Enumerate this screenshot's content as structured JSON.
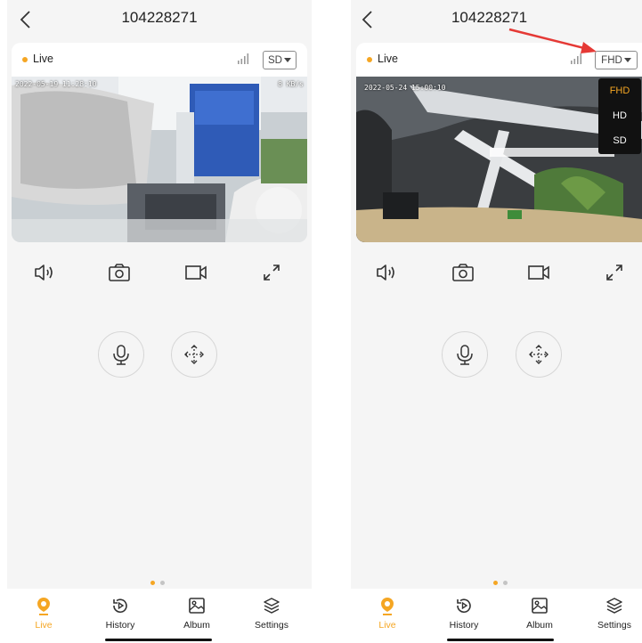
{
  "device_title": "104228271",
  "live_label": "Live",
  "left_screen": {
    "quality_label": "SD",
    "osd_timestamp": "2022-05-19 11:28:10",
    "osd_bitrate": "8 KB/s"
  },
  "right_screen": {
    "quality_label": "FHD",
    "osd_timestamp": "2022-05-24 15:00:10",
    "quality_menu": [
      "FHD",
      "HD",
      "SD"
    ],
    "quality_selected": "FHD"
  },
  "controls": [
    "speaker-icon",
    "snapshot-icon",
    "record-icon",
    "fullscreen-icon"
  ],
  "actions": [
    "microphone-icon",
    "ptz-icon"
  ],
  "tabs": [
    {
      "label": "Live",
      "icon": "live-pin-icon",
      "active": true
    },
    {
      "label": "History",
      "icon": "history-icon",
      "active": false
    },
    {
      "label": "Album",
      "icon": "album-icon",
      "active": false
    },
    {
      "label": "Settings",
      "icon": "settings-icon",
      "active": false
    }
  ],
  "pager": {
    "count": 2,
    "active_index": 0
  },
  "colors": {
    "accent": "#f5a623",
    "annotation_arrow": "#e53935",
    "menu_bg": "#111111"
  }
}
